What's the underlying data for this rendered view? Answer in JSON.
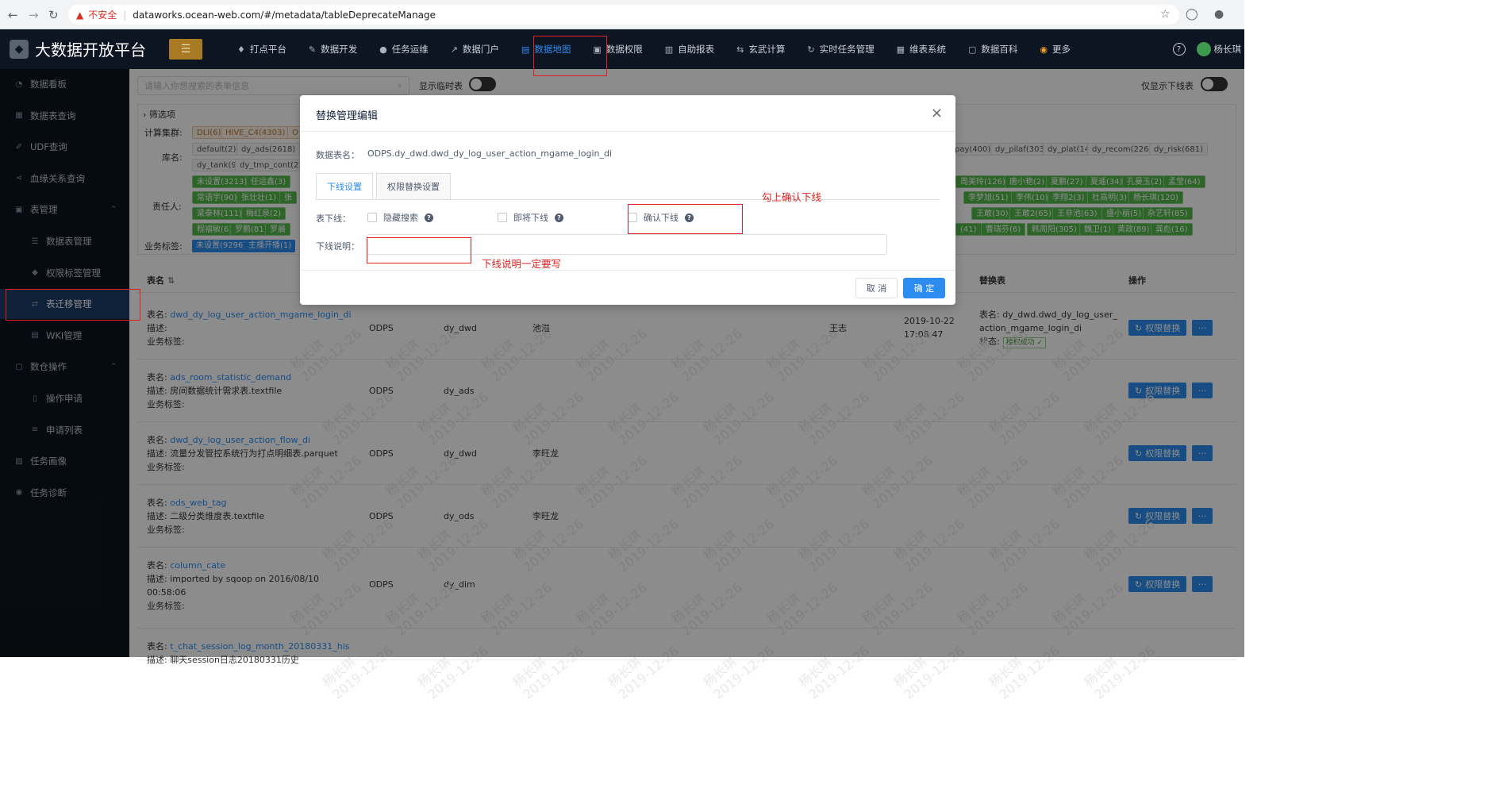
{
  "browser": {
    "insecure_label": "不安全",
    "url": "dataworks.ocean-web.com/#/metadata/tableDeprecateManage"
  },
  "header": {
    "app_title": "大数据开放平台",
    "nav": [
      {
        "label": "打点平台",
        "icon": "bulb-icon"
      },
      {
        "label": "数据开发",
        "icon": "pen-icon"
      },
      {
        "label": "任务运维",
        "icon": "pin-icon"
      },
      {
        "label": "数据门户",
        "icon": "chart-line-icon"
      },
      {
        "label": "数据地图",
        "icon": "map-doc-icon",
        "active": true
      },
      {
        "label": "数据权限",
        "icon": "lock-icon"
      },
      {
        "label": "自助报表",
        "icon": "bar-chart-icon"
      },
      {
        "label": "玄武计算",
        "icon": "swap-icon"
      },
      {
        "label": "实时任务管理",
        "icon": "refresh-icon"
      },
      {
        "label": "维表系统",
        "icon": "table-icon"
      },
      {
        "label": "数据百科",
        "icon": "book-icon"
      },
      {
        "label": "更多",
        "icon": "more-circle-icon"
      }
    ],
    "user_name": "杨长琪"
  },
  "sidebar": {
    "items": [
      {
        "label": "数据看板",
        "icon": "dashboard-icon"
      },
      {
        "label": "数据表查询",
        "icon": "table-icon"
      },
      {
        "label": "UDF查询",
        "icon": "wrench-icon"
      },
      {
        "label": "血缘关系查询",
        "icon": "share-icon"
      },
      {
        "label": "表管理",
        "icon": "clipboard-icon",
        "expanded": true
      },
      {
        "label": "数据表管理",
        "icon": "list-icon",
        "sub": true
      },
      {
        "label": "权限标签管理",
        "icon": "tag-icon",
        "sub": true
      },
      {
        "label": "表迁移管理",
        "icon": "transfer-icon",
        "sub": true,
        "active": true
      },
      {
        "label": "WKI管理",
        "icon": "doc-icon",
        "sub": true
      },
      {
        "label": "数仓操作",
        "icon": "lock-icon",
        "expanded": true
      },
      {
        "label": "操作申请",
        "icon": "file-icon",
        "sub": true
      },
      {
        "label": "申请列表",
        "icon": "menu-icon",
        "sub": true
      },
      {
        "label": "任务画像",
        "icon": "image-icon"
      },
      {
        "label": "任务诊断",
        "icon": "eye-icon"
      }
    ]
  },
  "toolbar": {
    "search_placeholder": "请输入你想搜索的表单信息",
    "show_temp_label": "显示临时表",
    "only_offline_label": "仅显示下线表"
  },
  "filter": {
    "title": "筛选项",
    "cluster_label": "计算集群:",
    "cluster_tags": [
      "DLI(6)",
      "HIVE_C4(4303)",
      "O"
    ],
    "db_label": "库名:",
    "db_tags_row1": [
      "default(2)",
      "dy_ads(2618)"
    ],
    "db_tags_row2": [
      "dy_tank(9)",
      "dy_tmp_cont(21"
    ],
    "db_tags_right": [
      "_pay(400)",
      "dy_pilaf(303)",
      "dy_plat(14)",
      "dy_recom(226)",
      "dy_risk(681)"
    ],
    "owner_label": "责任人:",
    "owner_left_row1": [
      "未设置(3213)",
      "任运鑫(3)"
    ],
    "owner_left_row2": [
      "常语宇(90)",
      "张壮壮(1)",
      "张"
    ],
    "owner_left_row3": [
      "梁泰林(111)",
      "梅红泉(2)"
    ],
    "owner_left_row4": [
      "程福敏(6)",
      "罗鹏(81)",
      "罗晨"
    ],
    "owner_right_row1": [
      "周美玲(126)",
      "唐小艳(2)",
      "夏鹏(27)",
      "夏遥(34)",
      "孔曼玉(2)",
      "孟莹(64)"
    ],
    "owner_right_row2": [
      "李梦旭(51)",
      "李伟(10)",
      "李翔2(3)",
      "杜高明(3)",
      "杨长琪(120)"
    ],
    "owner_right_row3": [
      "王敢(30)",
      "王敢2(65)",
      "王非池(63)",
      "盛小丽(5)",
      "杂艺轩(85)"
    ],
    "owner_right_row4": [
      "(41)",
      "曹瑞芬(6)",
      "韩周阳(305)",
      "魏卫(1)",
      "黄政(89)",
      "龚彪(16)"
    ],
    "biz_label": "业务标签:",
    "biz_tags": [
      "未设置(9296)",
      "主播开播(1)"
    ]
  },
  "table": {
    "headers": {
      "name": "表名",
      "replace": "替换表",
      "ops": "操作"
    },
    "rows": [
      {
        "name_key": "表名:",
        "name": "dwd_dy_log_user_action_mgame_login_di",
        "desc_key": "描述:",
        "desc": "",
        "biz_key": "业务标签:",
        "type": "ODPS",
        "db": "dy_dwd",
        "owner": "池溢",
        "approver": "王志",
        "date": "2019-10-22",
        "time": "17:08:47",
        "replace_key": "表名:",
        "replace": "dy_dwd.dwd_dy_log_user_action_mgame_login_di",
        "status_key": "状态:",
        "status": "授权成功 ✓",
        "op": "权限替换",
        "more": "···"
      },
      {
        "name_key": "表名:",
        "name": "ads_room_statistic_demand",
        "desc_key": "描述:",
        "desc": "房间数据统计需求表.textfile",
        "biz_key": "业务标签:",
        "type": "ODPS",
        "db": "dy_ads",
        "owner": "",
        "op": "权限替换",
        "more": "···"
      },
      {
        "name_key": "表名:",
        "name": "dwd_dy_log_user_action_flow_di",
        "desc_key": "描述:",
        "desc": "流量分发管控系统行为打点明细表.parquet",
        "biz_key": "业务标签:",
        "type": "ODPS",
        "db": "dy_dwd",
        "owner": "李旺龙",
        "op": "权限替换",
        "more": "···"
      },
      {
        "name_key": "表名:",
        "name": "ods_web_tag",
        "desc_key": "描述:",
        "desc": "二级分类维度表.textfile",
        "biz_key": "业务标签:",
        "type": "ODPS",
        "db": "dy_ods",
        "owner": "李旺龙",
        "op": "权限替换",
        "more": "···"
      },
      {
        "name_key": "表名:",
        "name": "column_cate",
        "desc_key": "描述:",
        "desc": "imported by sqoop on 2016/08/10",
        "desc2": "00:58:06",
        "biz_key": "业务标签:",
        "type": "ODPS",
        "db": "dy_dim",
        "owner": "",
        "op": "权限替换",
        "more": "···"
      },
      {
        "name_key": "表名:",
        "name": "t_chat_session_log_month_20180331_his",
        "desc_key": "描述:",
        "desc": "聊天session日志20180331历史",
        "biz_key": "",
        "type": "",
        "db": "",
        "owner": ""
      }
    ]
  },
  "watermark": {
    "name": "杨长琪",
    "date": "2019-12-26"
  },
  "modal": {
    "title": "替换管理编辑",
    "table_name_label": "数据表名：",
    "table_name_value": "ODPS.dy_dwd.dwd_dy_log_user_action_mgame_login_di",
    "tabs": [
      "下线设置",
      "权限替换设置"
    ],
    "offline_label": "表下线：",
    "checkboxes": [
      {
        "label": "隐藏搜索"
      },
      {
        "label": "即将下线"
      },
      {
        "label": "确认下线"
      }
    ],
    "desc_label": "下线说明：",
    "cancel_label": "取 消",
    "ok_label": "确 定"
  },
  "annotations": {
    "confirm_offline_note": "勾上确认下线",
    "desc_required_note": "下线说明一定要写"
  },
  "colors": {
    "accent": "#2d8cf0",
    "annotation": "#e02020",
    "topbar": "#0c1521"
  }
}
